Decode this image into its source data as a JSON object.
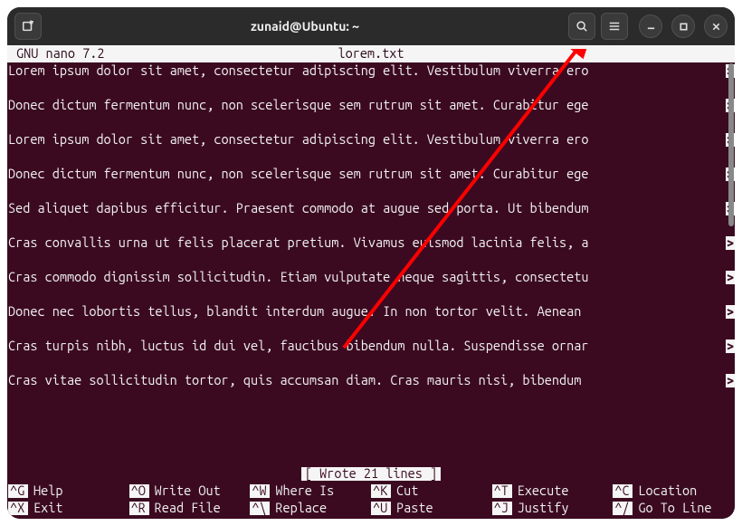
{
  "titlebar": {
    "title": "zunaid@Ubuntu: ~"
  },
  "nano": {
    "version": "GNU nano 7.2",
    "filename": "lorem.txt",
    "status": "[ Wrote 21 lines ]",
    "lines": [
      "Lorem ipsum dolor sit amet, consectetur adipiscing elit. Vestibulum viverra ero",
      "Donec dictum fermentum nunc, non scelerisque sem rutrum sit amet. Curabitur ege",
      "Lorem ipsum dolor sit amet, consectetur adipiscing elit. Vestibulum viverra ero",
      "Donec dictum fermentum nunc, non scelerisque sem rutrum sit amet. Curabitur ege",
      "Sed aliquet dapibus efficitur. Praesent commodo at augue sed porta. Ut bibendum",
      "Cras convallis urna ut felis placerat pretium. Vivamus euismod lacinia felis, a",
      "Cras commodo dignissim sollicitudin. Etiam vulputate neque sagittis, consectetu",
      "Donec nec lobortis tellus, blandit interdum augue. In non tortor velit. Aenean ",
      "Cras turpis nibh, luctus id dui vel, faucibus bibendum nulla. Suspendisse ornar",
      "Cras vitae sollicitudin tortor, quis accumsan diam. Cras mauris nisi, bibendum "
    ],
    "cont_marker": ">",
    "shortcuts": [
      {
        "key": "^G",
        "label": "Help"
      },
      {
        "key": "^O",
        "label": "Write Out"
      },
      {
        "key": "^W",
        "label": "Where Is"
      },
      {
        "key": "^K",
        "label": "Cut"
      },
      {
        "key": "^T",
        "label": "Execute"
      },
      {
        "key": "^C",
        "label": "Location"
      },
      {
        "key": "^X",
        "label": "Exit"
      },
      {
        "key": "^R",
        "label": "Read File"
      },
      {
        "key": "^\\",
        "label": "Replace"
      },
      {
        "key": "^U",
        "label": "Paste"
      },
      {
        "key": "^J",
        "label": "Justify"
      },
      {
        "key": "^/",
        "label": "Go To Line"
      }
    ]
  }
}
